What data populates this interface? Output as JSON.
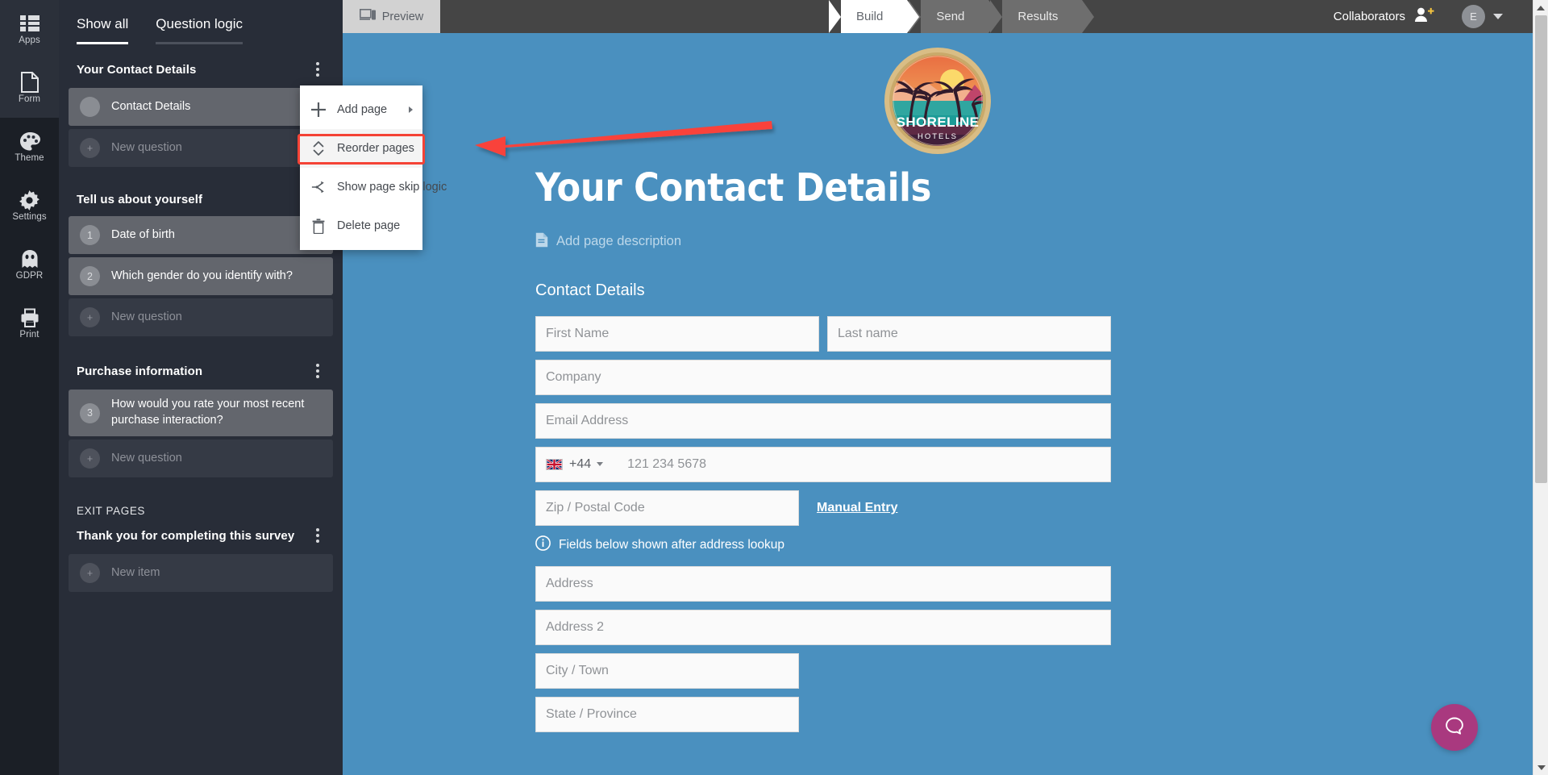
{
  "rail": {
    "items": [
      {
        "label": "Apps",
        "icon": "apps-grid-icon",
        "active": false
      },
      {
        "label": "Form",
        "icon": "document-icon",
        "active": true
      },
      {
        "label": "Theme",
        "icon": "palette-icon",
        "active": false
      },
      {
        "label": "Settings",
        "icon": "gear-icon",
        "active": false
      },
      {
        "label": "GDPR",
        "icon": "ghost-icon",
        "active": false
      },
      {
        "label": "Print",
        "icon": "printer-icon",
        "active": false
      }
    ]
  },
  "tree": {
    "tabs": [
      {
        "label": "Show all",
        "active": true
      },
      {
        "label": "Question logic",
        "active": false
      }
    ],
    "groups": [
      {
        "title": "Your Contact Details",
        "kebab": true,
        "caps": false,
        "rows": [
          {
            "bullet": "",
            "label": "Contact Details",
            "filled": true,
            "muted": false
          },
          {
            "bullet": "+",
            "label": "New question",
            "filled": false,
            "muted": true
          }
        ]
      },
      {
        "title": "Tell us about yourself",
        "kebab": false,
        "caps": false,
        "rows": [
          {
            "bullet": "1",
            "label": "Date of birth",
            "filled": true,
            "muted": false
          },
          {
            "bullet": "2",
            "label": "Which gender do you identify with?",
            "filled": true,
            "muted": false
          },
          {
            "bullet": "+",
            "label": "New question",
            "filled": false,
            "muted": true
          }
        ]
      },
      {
        "title": "Purchase information",
        "kebab": true,
        "caps": false,
        "rows": [
          {
            "bullet": "3",
            "label": "How would you rate your most recent purchase interaction?",
            "filled": true,
            "muted": false
          },
          {
            "bullet": "+",
            "label": "New question",
            "filled": false,
            "muted": true
          }
        ]
      },
      {
        "title": "EXIT PAGES",
        "kebab": false,
        "caps": true,
        "rows": []
      },
      {
        "title": "Thank you for completing this survey",
        "kebab": true,
        "caps": false,
        "rows": [
          {
            "bullet": "+",
            "label": "New item",
            "filled": false,
            "muted": true
          }
        ]
      }
    ]
  },
  "context_menu": {
    "items": [
      {
        "label": "Add page",
        "icon": "plus-icon",
        "submenu": true,
        "highlight": false
      },
      {
        "label": "Reorder pages",
        "icon": "updown-arrows-icon",
        "submenu": false,
        "highlight": true
      },
      {
        "label": "Show page skip logic",
        "icon": "branch-icon",
        "submenu": false,
        "highlight": false
      },
      {
        "label": "Delete page",
        "icon": "trash-icon",
        "submenu": false,
        "highlight": false
      }
    ],
    "highlight_color": "#f44336"
  },
  "topbar": {
    "preview_label": "Preview",
    "preview_icon": "devices-icon",
    "stages": [
      {
        "label": "Build",
        "active": true
      },
      {
        "label": "Send",
        "active": false
      },
      {
        "label": "Results",
        "active": false
      }
    ],
    "collaborators_label": "Collaborators",
    "collaborators_icon": "add-person-icon",
    "avatar_initial": "E"
  },
  "canvas": {
    "logo": {
      "brand": "SHORELINE",
      "sub": "HOTELS",
      "alt": "shoreline-hotels-logo"
    },
    "page_title": "Your Contact Details",
    "page_description_placeholder": "Add page description",
    "page_description_icon": "description-icon",
    "section_title": "Contact Details",
    "fields": [
      {
        "placeholder": "First Name",
        "width": "half",
        "name": "first-name-field"
      },
      {
        "placeholder": "Last name",
        "width": "half",
        "name": "last-name-field"
      },
      {
        "placeholder": "Company",
        "width": "full",
        "name": "company-field"
      },
      {
        "placeholder": "Email Address",
        "width": "full",
        "name": "email-field"
      }
    ],
    "phone": {
      "dial_code": "+44",
      "flag": "gb-flag-icon",
      "placeholder": "121 234 5678"
    },
    "zip": {
      "placeholder": "Zip / Postal Code"
    },
    "manual_entry_label": "Manual Entry",
    "lookup_note": "Fields below shown after address lookup",
    "lookup_note_icon": "info-icon",
    "address_fields": [
      {
        "placeholder": "Address",
        "width": "full",
        "name": "address-field"
      },
      {
        "placeholder": "Address 2",
        "width": "full",
        "name": "address2-field"
      },
      {
        "placeholder": "City / Town",
        "width": "zip",
        "name": "city-field"
      },
      {
        "placeholder": "State / Province",
        "width": "zip",
        "name": "state-field"
      }
    ],
    "accent_color": "#4a90bf",
    "help_icon": "chat-bubble-icon",
    "help_color": "#a9397f"
  }
}
